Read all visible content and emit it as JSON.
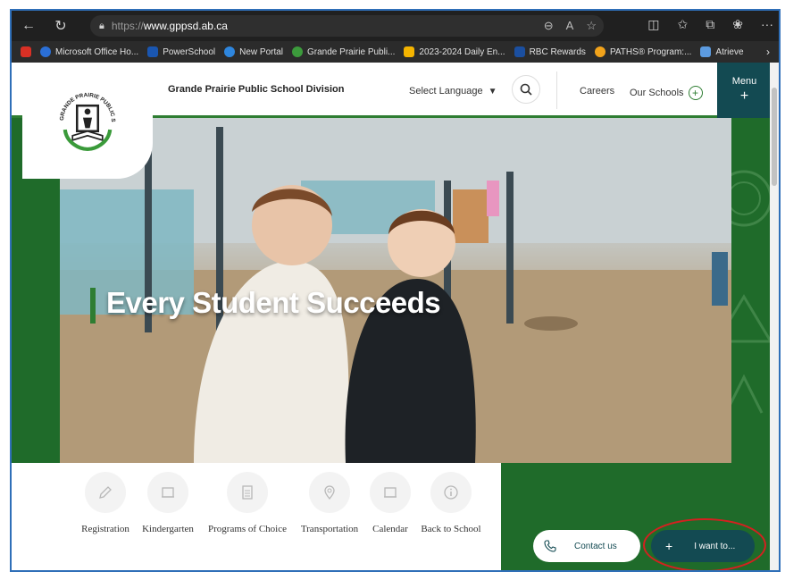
{
  "browser": {
    "url_protocol": "https://",
    "url_host": "www.gppsd.ab.ca",
    "bookmarks": [
      {
        "label": "Microsoft Office Ho...",
        "color": "#2b6fd6"
      },
      {
        "label": "PowerSchool",
        "color": "#1a56b0"
      },
      {
        "label": "New Portal",
        "color": "#2e86de"
      },
      {
        "label": "Grande Prairie Publi...",
        "color": "#3c9b3c"
      },
      {
        "label": "2023-2024 Daily En...",
        "color": "#f4b400"
      },
      {
        "label": "RBC Rewards",
        "color": "#1b4fa0"
      },
      {
        "label": "PATHS® Program:...",
        "color": "#f2a31b"
      },
      {
        "label": "Atrieve",
        "color": "#5c9be0"
      }
    ]
  },
  "header": {
    "division_name": "Grande Prairie Public School Division",
    "language": "Select Language",
    "careers": "Careers",
    "our_schools": "Our Schools",
    "menu": "Menu",
    "logo_text": "GRANDE PRAIRIE PUBLIC SCHOOL DIVISION"
  },
  "hero": {
    "title": "Every Student Succeeds"
  },
  "quick_links": [
    {
      "label": "Registration",
      "icon": "pencil-icon"
    },
    {
      "label": "Kindergarten",
      "icon": "tablet-icon"
    },
    {
      "label": "Programs of Choice",
      "icon": "document-icon"
    },
    {
      "label": "Transportation",
      "icon": "map-pin-icon"
    },
    {
      "label": "Calendar",
      "icon": "tablet-icon"
    },
    {
      "label": "Back to School",
      "icon": "info-icon"
    }
  ],
  "actions": {
    "contact": "Contact us",
    "i_want_to": "I want to..."
  },
  "colors": {
    "brand_dark": "#134a52",
    "brand_green": "#2e7d32",
    "annotation": "#d42020"
  }
}
